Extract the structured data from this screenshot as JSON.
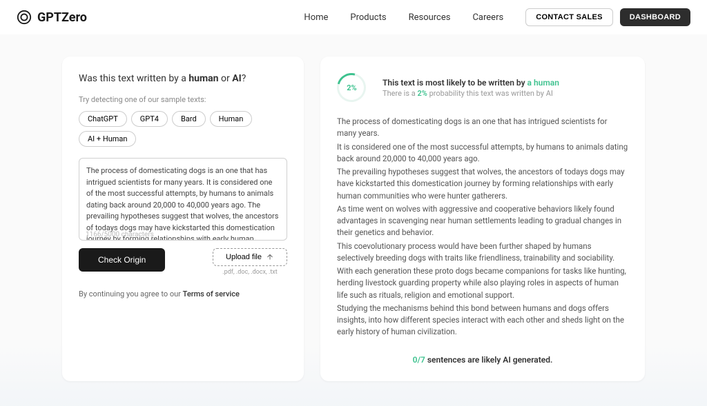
{
  "header": {
    "brand": "GPTZero",
    "nav": {
      "home": "Home",
      "products": "Products",
      "resources": "Resources",
      "careers": "Careers"
    },
    "buttons": {
      "contact": "CONTACT SALES",
      "dashboard": "DASHBOARD"
    }
  },
  "left": {
    "question_prefix": "Was this text written by a ",
    "question_human": "human",
    "question_or": " or ",
    "question_ai": "AI",
    "question_suffix": "?",
    "sample_label": "Try detecting one of our sample texts:",
    "chips": {
      "chatgpt": "ChatGPT",
      "gpt4": "GPT4",
      "bard": "Bard",
      "human": "Human",
      "aihuman": "AI + Human"
    },
    "textarea_value": "The process of domesticating dogs is an one that has intrigued scientists for many years. It is considered one of the most successful attempts, by humans to animals dating back around 20,000 to 40,000 years ago. The prevailing hypotheses suggest that wolves, the ancestors of todays dogs may have kickstarted this domestication journey by forming relationships with early human communities who were hunter gatherers. As time went",
    "char_count": "1166/5000 characters",
    "check_button": "Check Origin",
    "upload_button": "Upload file",
    "upload_formats": ".pdf, .doc, .docx, .txt",
    "terms_prefix": "By continuing you agree to our ",
    "terms_link": "Terms of service"
  },
  "right": {
    "percent": "2%",
    "title_prefix": "This text is most likely to be written by ",
    "title_highlight": "a human",
    "sub_prefix": "There is a ",
    "sub_pct": "2%",
    "sub_suffix": " probability this text was written by AI",
    "paragraphs": [
      "The process of domesticating dogs is an one that has intrigued scientists for many years.",
      "It is considered one of the most successful attempts, by humans to animals dating back around 20,000 to 40,000 years ago.",
      "The prevailing hypotheses suggest that wolves, the ancestors of todays dogs may have kickstarted this domestication journey by forming relationships with early human communities who were hunter gatherers.",
      "As time went on wolves with aggressive and cooperative behaviors likely found advantages in scavenging near human settlements leading to gradual changes in their genetics and behavior.",
      "This coevolutionary process would have been further shaped by humans selectively breeding dogs with traits like friendliness, trainability and sociability.",
      "With each generation these proto dogs became companions for tasks like hunting, herding livestock guarding property while also playing roles in aspects of human life such as rituals, religion and emotional support.",
      "Studying the mechanisms behind this bond between humans and dogs offers insights, into how different species interact with each other and sheds light on the early history of human civilization."
    ],
    "sentence_ratio": "0/7",
    "sentence_text": " sentences are likely AI generated."
  }
}
